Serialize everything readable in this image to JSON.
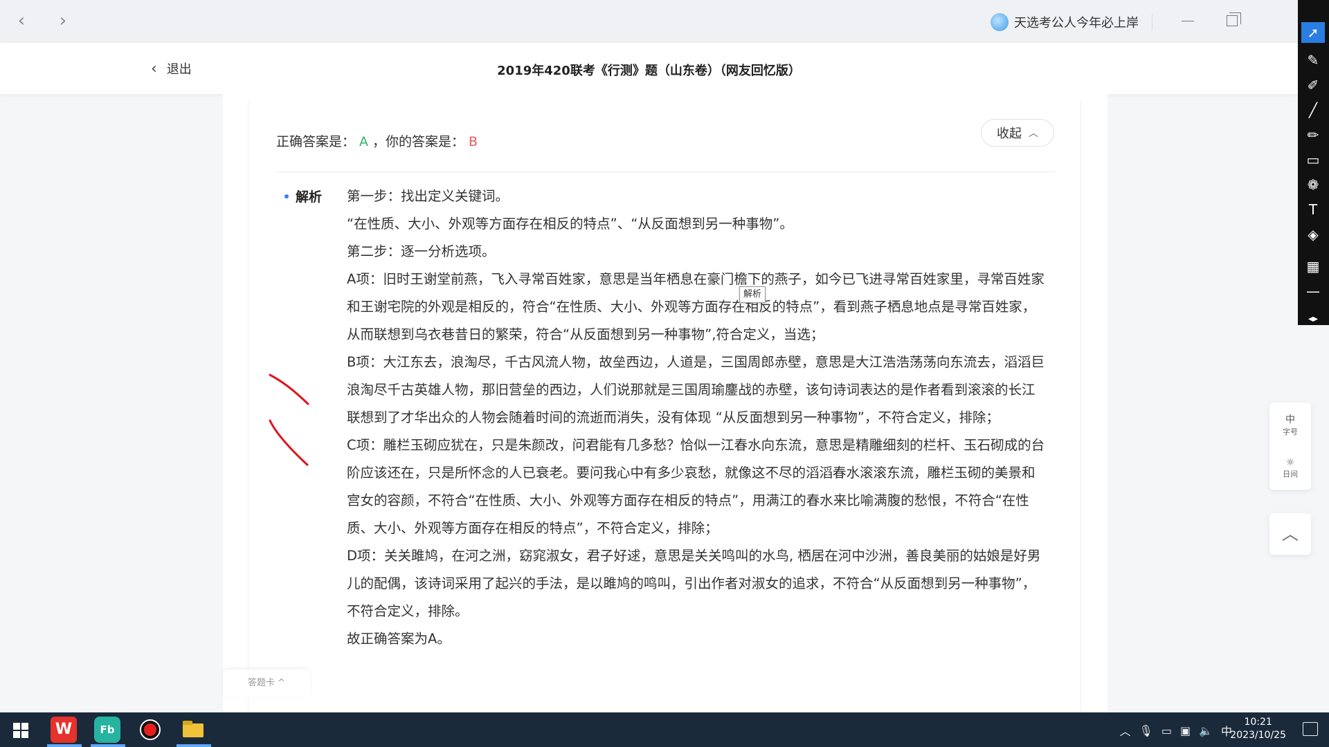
{
  "window": {
    "user_name": "天选考公人今年必上岸"
  },
  "header": {
    "exit_label": "退出",
    "title": "2019年420联考《行测》题（山东卷）（网友回忆版）"
  },
  "answer": {
    "correct_label": "正确答案是：",
    "correct_value": "A",
    "separator": "，",
    "yours_label": "你的答案是：",
    "yours_value": "B",
    "collapse_label": "收起"
  },
  "analysis": {
    "label": "解析",
    "paragraphs": [
      "第一步：找出定义关键词。",
      "“在性质、大小、外观等方面存在相反的特点”、“从反面想到另一种事物”。",
      "第二步：逐一分析选项。",
      "A项：旧时王谢堂前燕，飞入寻常百姓家，意思是当年栖息在豪门檐下的燕子，如今已飞进寻常百姓家里，寻常百姓家和王谢宅院的外观是相反的，符合“在性质、大小、外观等方面存在相反的特点”，看到燕子栖息地点是寻常百姓家，从而联想到乌衣巷昔日的繁荣，符合“从反面想到另一种事物”,符合定义，当选；",
      "B项：大江东去，浪淘尽，千古风流人物，故垒西边，人道是，三国周郎赤壁，意思是大江浩浩荡荡向东流去，滔滔巨浪淘尽千古英雄人物，那旧营垒的西边，人们说那就是三国周瑜鏖战的赤壁，该句诗词表达的是作者看到滚滚的长江联想到了才华出众的人物会随着时间的流逝而消失，没有体现 “从反面想到另一种事物”，不符合定义，排除；",
      "C项：雕栏玉砌应犹在，只是朱颜改，问君能有几多愁？恰似一江春水向东流，意思是精雕细刻的栏杆、玉石砌成的台阶应该还在，只是所怀念的人已衰老。要问我心中有多少哀愁，就像这不尽的滔滔春水滚滚东流，雕栏玉砌的美景和宫女的容颜，不符合“在性质、大小、外观等方面存在相反的特点”，用满江的春水来比喻满腹的愁恨，不符合“在性质、大小、外观等方面存在相反的特点”，不符合定义，排除；",
      "D项：关关雎鸠，在河之洲，窈窕淑女，君子好逑，意思是关关鸣叫的水鸟, 栖居在河中沙洲，善良美丽的姑娘是好男儿的配偶，该诗词采用了起兴的手法，是以雎鸠的鸣叫，引出作者对淑女的追求，不符合“从反面想到另一种事物”，不符合定义，排除。",
      "故正确答案为A。"
    ]
  },
  "tooltip": "解析",
  "answer_card_tab": "答题卡 ^",
  "side_tools": {
    "font_size_big": "中",
    "font_size_label": "字号",
    "theme_label": "日间"
  },
  "annotation_colors": {
    "ink": "#e0141e"
  },
  "taskbar": {
    "ime": "中",
    "time": "10:21",
    "date": "2023/10/25"
  },
  "colors": {
    "correct": "#2fb36a",
    "wrong": "#e85b5b",
    "accent": "#3d7cf0"
  }
}
